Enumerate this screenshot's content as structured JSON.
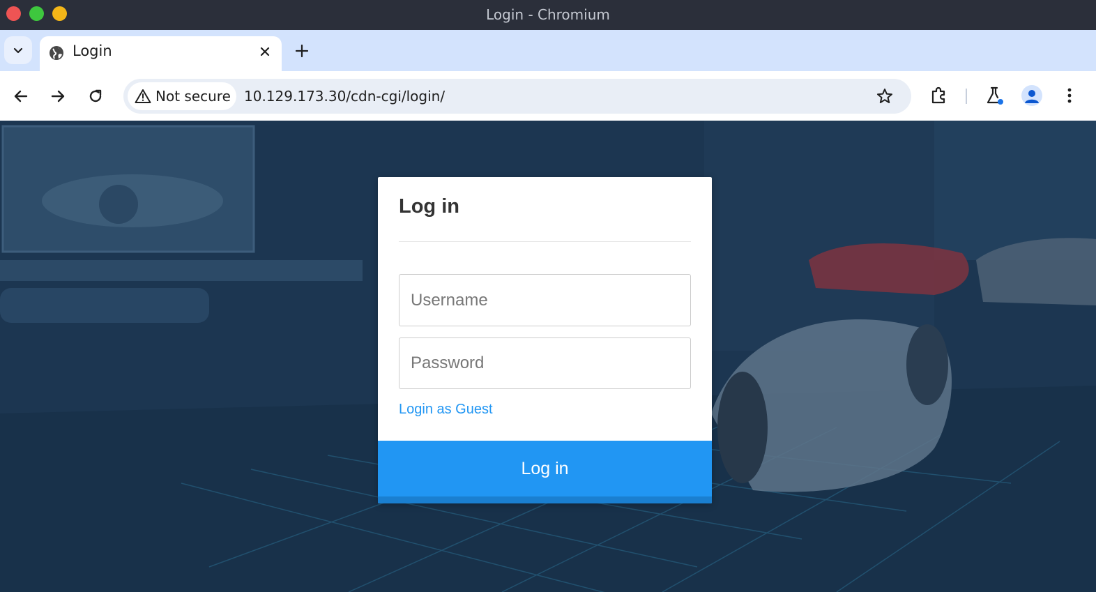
{
  "window": {
    "title": "Login - Chromium"
  },
  "tabs": [
    {
      "label": "Login",
      "active": true,
      "favicon": "globe-icon"
    }
  ],
  "toolbar": {
    "security_label": "Not secure",
    "url": "10.129.173.30/cdn-cgi/login/"
  },
  "login": {
    "title": "Log in",
    "username_placeholder": "Username",
    "password_placeholder": "Password",
    "guest_link": "Login as Guest",
    "submit_label": "Log in"
  },
  "colors": {
    "accent": "#2196f3",
    "tab_strip": "#d3e3fd",
    "titlebar": "#2b2f3a",
    "page_overlay": "#1f3b57"
  }
}
